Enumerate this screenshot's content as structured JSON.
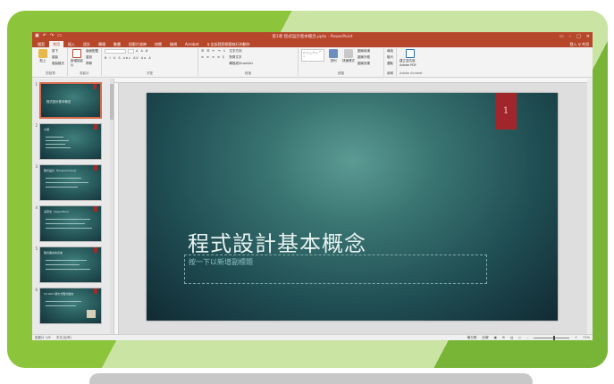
{
  "colors": {
    "frame_green": "#8cc43c",
    "accent_red": "#b7472a",
    "slide_number_red": "#a1262b",
    "slide_teal": "#3a7572"
  },
  "window": {
    "title": "第1章 程式設計基本概念.pptx - PowerPoint",
    "quick_access": [
      "save-icon",
      "undo-icon",
      "redo-icon",
      "start-from-beginning-icon"
    ],
    "controls": [
      "restore-ribbon-icon",
      "minimize-icon",
      "maximize-icon",
      "close-icon"
    ]
  },
  "tabs": [
    "檔案",
    "常用",
    "插入",
    "設計",
    "轉場",
    "動畫",
    "投影片放映",
    "校閱",
    "檢視",
    "Acrobat",
    "♀ 告訴我您想要執行的動作"
  ],
  "active_tab": "常用",
  "account": {
    "user": "登入",
    "share": "♀ 共用"
  },
  "ribbon": {
    "clipboard": {
      "label": "剪貼簿",
      "paste": "貼上",
      "cut": "剪下",
      "copy": "複製",
      "format_painter": "複製格式"
    },
    "slides": {
      "label": "投影片",
      "new_slide": "新增投影片",
      "layout": "版面配置",
      "reset": "重設",
      "section": "章節"
    },
    "font": {
      "label": "字型",
      "font_name": "",
      "font_size": "",
      "format_buttons": "B I U S abc AV Aa A"
    },
    "paragraph": {
      "label": "段落",
      "text_direction": "文字方向",
      "align_text": "對齊文字",
      "smartart": "轉換成SmartArt"
    },
    "drawing": {
      "label": "繪圖",
      "arrange": "排列",
      "quick_styles": "快速樣式",
      "shape_fill": "圖案填滿",
      "shape_outline": "圖案外框",
      "shape_effects": "圖案效果"
    },
    "editing": {
      "label": "編輯",
      "find": "尋找",
      "replace": "取代",
      "select": "選取"
    },
    "acrobat": {
      "label": "Adobe Acrobat",
      "button": "建立並共用 Adobe PDF"
    }
  },
  "thumbnails": [
    {
      "number": "1",
      "title": "程式設計基本概念",
      "selected": true
    },
    {
      "number": "2",
      "head": "大綱"
    },
    {
      "number": "3",
      "head": "程式設計（Programming）"
    },
    {
      "number": "4",
      "head": "演算法（Algorithm）"
    },
    {
      "number": "5",
      "head": "程式語言的演進"
    },
    {
      "number": "6",
      "head": "Scratch 積木式程式語言"
    }
  ],
  "slide": {
    "number": "1",
    "title": "程式設計基本概念",
    "subtitle_placeholder": "按一下以新增副標題"
  },
  "statusbar": {
    "slide_position": "投影片 1/6",
    "language": "中文(台灣)",
    "notes": "備忘稿",
    "comments": "註解",
    "views": [
      "normal-view-icon",
      "slide-sorter-icon",
      "reading-view-icon",
      "slideshow-icon"
    ],
    "zoom": "71%",
    "zoom_level": 0.55
  }
}
